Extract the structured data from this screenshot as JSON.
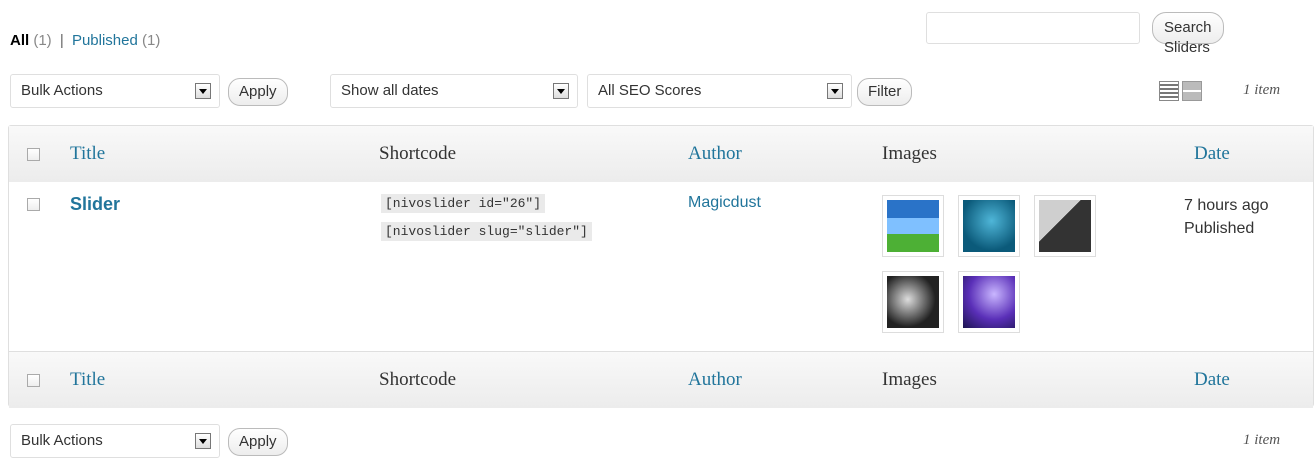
{
  "views": {
    "all_label": "All",
    "all_count": "(1)",
    "separator": "|",
    "published_label": "Published",
    "published_count": "(1)"
  },
  "search": {
    "placeholder": "",
    "button_label": "Search Sliders"
  },
  "top_nav": {
    "bulk_actions": "Bulk Actions",
    "apply_label": "Apply",
    "dates_filter": "Show all dates",
    "seo_filter": "All SEO Scores",
    "filter_label": "Filter",
    "item_count": "1 item"
  },
  "table": {
    "columns": {
      "title": "Title",
      "shortcode": "Shortcode",
      "author": "Author",
      "images": "Images",
      "date": "Date"
    },
    "rows": [
      {
        "title": "Slider",
        "shortcode_1": "[nivoslider id=\"26\"]",
        "shortcode_2": "[nivoslider slug=\"slider\"]",
        "author": "Magicdust",
        "date": "7 hours ago",
        "status": "Published"
      }
    ]
  },
  "bottom_nav": {
    "bulk_actions": "Bulk Actions",
    "apply_label": "Apply",
    "item_count": "1 item"
  },
  "colors": {
    "link": "#21759b",
    "header_bg": "#ececec"
  }
}
